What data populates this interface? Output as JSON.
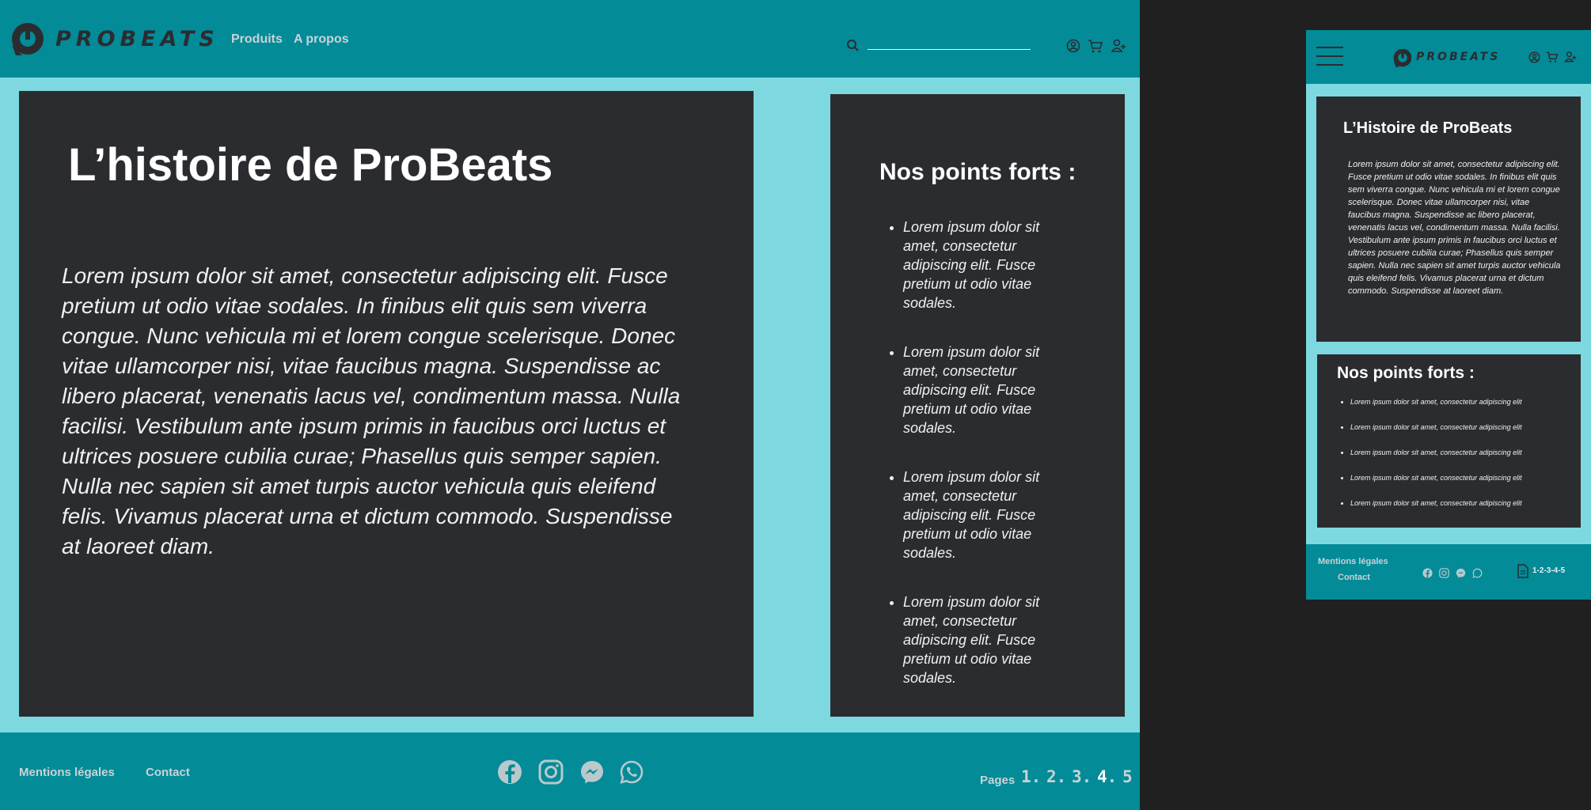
{
  "brand": {
    "name": "PROBEATS"
  },
  "nav": {
    "items": [
      {
        "label": "Produits"
      },
      {
        "label": "A propos"
      }
    ]
  },
  "search": {
    "placeholder": ""
  },
  "main": {
    "title": "L’histoire de ProBeats",
    "body": "Lorem ipsum dolor sit amet, consectetur adipiscing elit. Fusce pretium ut odio vitae sodales. In finibus elit quis sem viverra congue. Nunc vehicula mi et lorem congue scelerisque. Donec vitae ullamcorper nisi, vitae faucibus magna. Suspendisse ac libero placerat, venenatis lacus vel, condimentum massa. Nulla facilisi. Vestibulum ante ipsum primis in faucibus orci luctus et ultrices posuere cubilia curae; Phasellus quis semper sapien. Nulla nec sapien sit amet turpis auctor vehicula quis eleifend felis. Vivamus placerat urna et dictum commodo. Suspendisse at laoreet diam."
  },
  "sidebar": {
    "title": "Nos points forts :",
    "items": [
      "Lorem ipsum dolor sit amet, consectetur adipiscing elit. Fusce pretium ut odio vitae sodales.",
      "Lorem ipsum dolor sit amet, consectetur adipiscing elit. Fusce pretium ut odio vitae sodales.",
      "Lorem ipsum dolor sit amet, consectetur adipiscing elit. Fusce pretium ut odio vitae sodales.",
      "Lorem ipsum dolor sit amet, consectetur adipiscing elit. Fusce pretium ut odio vitae sodales."
    ]
  },
  "footer": {
    "legal": "Mentions légales",
    "contact": "Contact",
    "pages_label": "Pages",
    "pages": [
      "1",
      "2",
      "3",
      "4",
      "5"
    ],
    "active_page": "4"
  },
  "mobile": {
    "title": "L’Histoire de ProBeats",
    "body": "Lorem ipsum dolor sit amet, consectetur adipiscing elit. Fusce pretium ut odio vitae sodales. In finibus elit quis sem viverra congue. Nunc vehicula mi et lorem congue scelerisque. Donec vitae ullamcorper nisi, vitae faucibus magna. Suspendisse ac libero placerat, venenatis lacus vel, condimentum massa. Nulla facilisi. Vestibulum ante ipsum primis in faucibus orci luctus et ultrices posuere cubilia curae; Phasellus quis semper sapien. Nulla nec sapien sit amet turpis auctor vehicula quis eleifend felis. Vivamus placerat urna et dictum commodo. Suspendisse at laoreet diam.",
    "points_title": "Nos points forts :",
    "points": [
      "Lorem ipsum dolor sit amet, consectetur adipiscing elit",
      "Lorem ipsum dolor sit amet, consectetur adipiscing elit",
      "Lorem ipsum dolor sit amet, consectetur adipiscing elit",
      "Lorem ipsum dolor sit amet, consectetur adipiscing elit",
      "Lorem ipsum dolor sit amet, consectetur adipiscing elit"
    ],
    "legal": "Mentions légales",
    "contact": "Contact",
    "pages": "1-2-3-4-5"
  },
  "colors": {
    "teal": "#038b98",
    "light": "#7dd9df",
    "dark": "#2b2c30",
    "bg": "#202020"
  },
  "icons": [
    "logo-icon",
    "search-icon",
    "user-icon",
    "cart-icon",
    "account-icon",
    "facebook-icon",
    "instagram-icon",
    "messenger-icon",
    "whatsapp-icon",
    "menu-icon",
    "document-icon"
  ]
}
